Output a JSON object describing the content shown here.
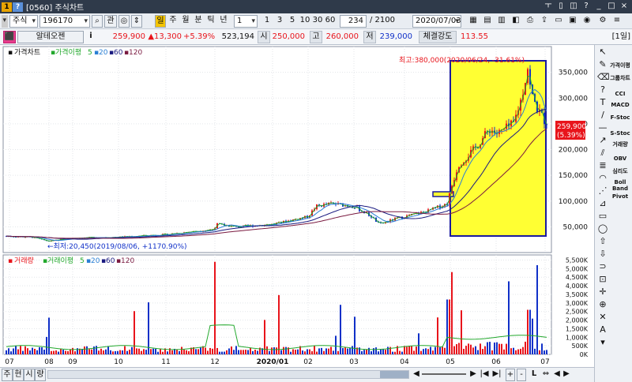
{
  "window": {
    "icon_a": "1",
    "icon_b": "?",
    "title": "[0560] 주식차트",
    "buttons": [
      "ㅜ",
      "▯",
      "◫",
      "?",
      "_",
      "□",
      "×"
    ]
  },
  "toolbar1": {
    "market": "주식",
    "code": "196170",
    "gwan": "관",
    "period_selected": "일",
    "periods": [
      "주",
      "월",
      "분",
      "틱",
      "년"
    ],
    "unit": "1",
    "units": [
      "1",
      "3",
      "5",
      "10",
      "30",
      "60"
    ],
    "count": "234",
    "count_total": "/ 2100",
    "date": "2020/07/03"
  },
  "toolbar2": {
    "name": "알테오젠",
    "info": "i",
    "price": "259,900",
    "change": "▲13,300",
    "change_pct": "+5.39%",
    "volume": "523,194",
    "open_label": "시",
    "open": "250,000",
    "high_label": "고",
    "high": "260,000",
    "low_label": "저",
    "low": "239,000",
    "strength_label": "체결강도",
    "strength": "113.55",
    "period_badge": "[1일]"
  },
  "price_panel": {
    "legend": {
      "title": "가격차트",
      "ma_label": "가격이평",
      "ma": [
        "5",
        "20",
        "60",
        "120"
      ]
    },
    "max_label": "최고:380,000(2020/06/24, -31.61%)",
    "min_label": "←최저:20,450(2019/08/06, +1170.90%)",
    "current_price": "259,900",
    "current_pct": "(5.39%)",
    "y_ticks": [
      "350,000",
      "300,000",
      "250,000",
      "200,000",
      "150,000",
      "100,000",
      "50,000"
    ]
  },
  "volume_panel": {
    "legend": {
      "title": "거래량",
      "ma_label": "거래이평",
      "ma": [
        "5",
        "20",
        "60",
        "120"
      ]
    },
    "y_ticks": [
      "5,500K",
      "5,000K",
      "4,500K",
      "4,000K",
      "3,500K",
      "3,000K",
      "2,500K",
      "2,000K",
      "1,500K",
      "1,000K",
      "500K",
      "0K"
    ]
  },
  "x_ticks": [
    "07",
    "08",
    "09",
    "10",
    "11",
    "12",
    "2020/01",
    "02",
    "03",
    "04",
    "05",
    "06",
    "07"
  ],
  "bottom_tabs": [
    "주",
    "현",
    "시",
    "량"
  ],
  "bottom_buttons": [
    "◀",
    "▶",
    "|◀",
    "▶|",
    "+",
    "-",
    "L",
    "⇔",
    "◀",
    "▶"
  ],
  "right_tools": [
    "가격이평",
    "그룹차트",
    "CCI",
    "MACD",
    "F-Stoc",
    "S-Stoc",
    "거래량",
    "OBV",
    "심리도",
    "Boll Band",
    "Pivot"
  ],
  "colors": {
    "up": "#e8141b",
    "down": "#1030c8",
    "ma5": "#22a82c",
    "ma20": "#2a7fd4",
    "ma60": "#1a1a80",
    "ma120": "#7a1a40",
    "highlight_fill": "#ffff33",
    "highlight_border": "#1a1aa0"
  }
}
